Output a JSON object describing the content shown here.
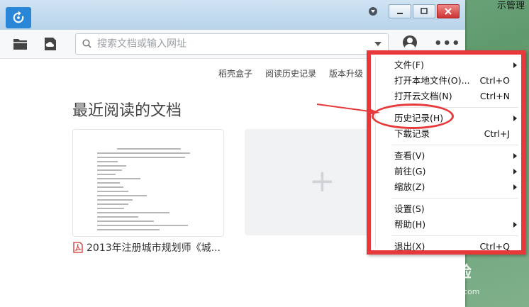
{
  "desktop": {
    "corner_label": "示管理"
  },
  "search": {
    "placeholder": "搜索文档或输入网址"
  },
  "links": [
    "稻壳盒子",
    "阅读历史记录",
    "版本升级"
  ],
  "section_title": "最近阅读的文档",
  "recent_docs": [
    {
      "name": "2013年注册城市规划师《城..."
    }
  ],
  "add_card": {
    "symbol": "+"
  },
  "menu": {
    "groups": [
      [
        {
          "label": "文件(F)",
          "shortcut": "",
          "submenu": true
        },
        {
          "label": "打开本地文件(O)...",
          "shortcut": "Ctrl+O",
          "submenu": false
        },
        {
          "label": "打开云文档(N)",
          "shortcut": "Ctrl+N",
          "submenu": false
        }
      ],
      [
        {
          "label": "历史记录(H)",
          "shortcut": "",
          "submenu": true
        },
        {
          "label": "下载记录",
          "shortcut": "Ctrl+J",
          "submenu": false
        }
      ],
      [
        {
          "label": "查看(V)",
          "shortcut": "",
          "submenu": true
        },
        {
          "label": "前往(G)",
          "shortcut": "",
          "submenu": true
        },
        {
          "label": "缩放(Z)",
          "shortcut": "",
          "submenu": true
        }
      ],
      [
        {
          "label": "设置(S)",
          "shortcut": "",
          "submenu": false
        },
        {
          "label": "帮助(H)",
          "shortcut": "",
          "submenu": true
        }
      ],
      [
        {
          "label": "退出(X)",
          "shortcut": "Ctrl+Q",
          "submenu": false
        }
      ]
    ]
  },
  "watermark": {
    "main": "Bai 经验",
    "sub": "jingyan.baidu.com"
  },
  "colors": {
    "accent": "#2a86d6",
    "annotation": "#e7393b"
  }
}
